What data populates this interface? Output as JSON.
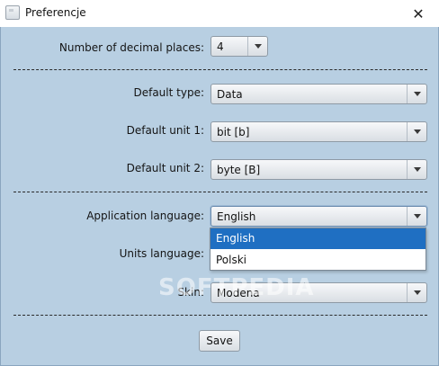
{
  "window": {
    "title": "Preferencje",
    "close_glyph": "✕"
  },
  "form": {
    "decimal_places": {
      "label": "Number of decimal places:",
      "value": "4"
    },
    "default_type": {
      "label": "Default type:",
      "value": "Data"
    },
    "default_unit_1": {
      "label": "Default unit 1:",
      "value": "bit [b]"
    },
    "default_unit_2": {
      "label": "Default unit 2:",
      "value": "byte [B]"
    },
    "app_language": {
      "label": "Application language:",
      "value": "English",
      "options": [
        "English",
        "Polski"
      ],
      "selected": "English",
      "expanded": true
    },
    "units_language": {
      "label": "Units language:"
    },
    "skin": {
      "label": "Skin:",
      "value": "Modena"
    }
  },
  "save_button": {
    "label": "Save"
  },
  "watermark": {
    "text": "SOFTPEDIA"
  },
  "colors": {
    "client_bg": "#b8cfe2",
    "selection": "#1f6fc2"
  },
  "icons": {
    "app": "window-icon",
    "close": "close-icon",
    "dropdown": "chevron-down-icon"
  }
}
